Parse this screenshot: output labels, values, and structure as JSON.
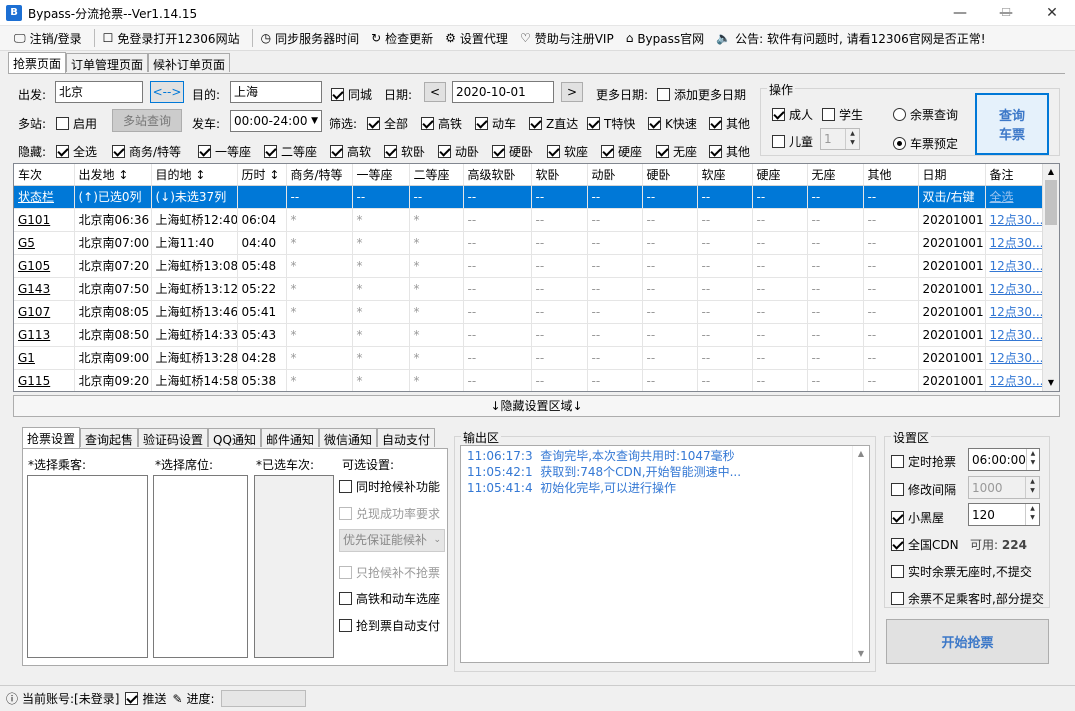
{
  "window": {
    "title": "Bypass-分流抢票--Ver1.14.15",
    "min_glyph": "—",
    "max_glyph": "☐",
    "close_glyph": "✕"
  },
  "menu": [
    {
      "icon": "monitor-icon",
      "glyph": "🖵",
      "label": "注销/登录"
    },
    {
      "icon": "window-icon",
      "glyph": "☐",
      "label": "免登录打开12306网站"
    },
    {
      "icon": "clock-icon",
      "glyph": "◷",
      "label": "同步服务器时间"
    },
    {
      "icon": "refresh-icon",
      "glyph": "↻",
      "label": "检查更新"
    },
    {
      "icon": "gear-icon",
      "glyph": "⚙",
      "label": "设置代理"
    },
    {
      "icon": "heart-icon",
      "glyph": "♡",
      "label": "赞助与注册VIP"
    },
    {
      "icon": "home-icon",
      "glyph": "⌂",
      "label": "Bypass官网"
    },
    {
      "icon": "speaker-icon",
      "glyph": "🔈",
      "label": "公告: 软件有问题时, 请看12306官网是否正常!"
    }
  ],
  "tabs": [
    "抢票页面",
    "订单管理页面",
    "候补订单页面"
  ],
  "query": {
    "from_label": "出发:",
    "from_value": "北京",
    "swap_label": "<-->",
    "to_label": "目的:",
    "to_value": "上海",
    "same_city": "同城",
    "date_label": "日期:",
    "date_value": "2020-10-01",
    "prev": "<",
    "next": ">",
    "more_dates_label": "更多日期:",
    "add_dates": "添加更多日期",
    "multi_label": "多站:",
    "enable": "启用",
    "multi_query": "多站查询",
    "depart_label": "发车:",
    "depart_value": "00:00-24:00",
    "filter_label": "筛选:",
    "filters": [
      "全部",
      "高铁",
      "动车",
      "Z直达",
      "T特快",
      "K快速",
      "其他"
    ],
    "hide_label": "隐藏:",
    "hides": [
      "全选",
      "商务/特等",
      "一等座",
      "二等座",
      "高软",
      "软卧",
      "动卧",
      "硬卧",
      "软座",
      "硬座",
      "无座",
      "其他"
    ]
  },
  "ops": {
    "title": "操作",
    "adult": "成人",
    "student": "学生",
    "child": "儿童",
    "child_count": "1",
    "remain_query": "余票查询",
    "book": "车票预定",
    "query_btn_1": "查询",
    "query_btn_2": "车票"
  },
  "table": {
    "headers": [
      "车次",
      "出发地 ↕",
      "目的地 ↕",
      "历时 ↕",
      "商务/特等",
      "一等座",
      "二等座",
      "高级软卧",
      "软卧",
      "动卧",
      "硬卧",
      "软座",
      "硬座",
      "无座",
      "其他",
      "日期",
      "备注"
    ],
    "rows": [
      [
        "状态栏",
        "(↑)已选0列",
        "(↓)未选37列",
        "",
        "--",
        "--",
        "--",
        "--",
        "--",
        "--",
        "--",
        "--",
        "--",
        "--",
        "--",
        "双击/右键",
        "全选"
      ],
      [
        "G101",
        "北京南06:36",
        "上海虹桥12:40",
        "06:04",
        "*",
        "*",
        "*",
        "--",
        "--",
        "--",
        "--",
        "--",
        "--",
        "--",
        "--",
        "20201001",
        "12点30..."
      ],
      [
        "G5",
        "北京南07:00",
        "上海11:40",
        "04:40",
        "*",
        "*",
        "*",
        "--",
        "--",
        "--",
        "--",
        "--",
        "--",
        "--",
        "--",
        "20201001",
        "12点30..."
      ],
      [
        "G105",
        "北京南07:20",
        "上海虹桥13:08",
        "05:48",
        "*",
        "*",
        "*",
        "--",
        "--",
        "--",
        "--",
        "--",
        "--",
        "--",
        "--",
        "20201001",
        "12点30..."
      ],
      [
        "G143",
        "北京南07:50",
        "上海虹桥13:12",
        "05:22",
        "*",
        "*",
        "*",
        "--",
        "--",
        "--",
        "--",
        "--",
        "--",
        "--",
        "--",
        "20201001",
        "12点30..."
      ],
      [
        "G107",
        "北京南08:05",
        "上海虹桥13:46",
        "05:41",
        "*",
        "*",
        "*",
        "--",
        "--",
        "--",
        "--",
        "--",
        "--",
        "--",
        "--",
        "20201001",
        "12点30..."
      ],
      [
        "G113",
        "北京南08:50",
        "上海虹桥14:33",
        "05:43",
        "*",
        "*",
        "*",
        "--",
        "--",
        "--",
        "--",
        "--",
        "--",
        "--",
        "--",
        "20201001",
        "12点30..."
      ],
      [
        "G1",
        "北京南09:00",
        "上海虹桥13:28",
        "04:28",
        "*",
        "*",
        "*",
        "--",
        "--",
        "--",
        "--",
        "--",
        "--",
        "--",
        "--",
        "20201001",
        "12点30..."
      ],
      [
        "G115",
        "北京南09:20",
        "上海虹桥14:58",
        "05:38",
        "*",
        "*",
        "*",
        "--",
        "--",
        "--",
        "--",
        "--",
        "--",
        "--",
        "--",
        "20201001",
        "12点30..."
      ]
    ]
  },
  "hide_bar": "↓隐藏设置区域↓",
  "bottom_tabs": [
    "抢票设置",
    "查询起售",
    "验证码设置",
    "QQ通知",
    "邮件通知",
    "微信通知",
    "自动支付"
  ],
  "grab": {
    "passengers": "*选择乘客:",
    "seats": "*选择席位:",
    "trains": "*已选车次:",
    "options": "可选设置:",
    "opt_waitlist": "同时抢候补功能",
    "opt_success": "兑现成功率要求",
    "opt_priority": "优先保证能候补",
    "opt_only_wait": "只抢候补不抢票",
    "opt_mixed": "高铁和动车选座",
    "opt_autopay": "抢到票自动支付"
  },
  "output": {
    "title": "输出区",
    "lines": [
      {
        "time": "11:06:17:3",
        "msg": "查询完毕,本次查询共用时:1047毫秒"
      },
      {
        "time": "11:05:42:1",
        "msg": "获取到:748个CDN,开始智能测速中..."
      },
      {
        "time": "11:05:41:4",
        "msg": "初始化完毕,可以进行操作"
      }
    ]
  },
  "settings": {
    "title": "设置区",
    "timed": "定时抢票",
    "timed_value": "06:00:00",
    "interval": "修改间隔",
    "interval_value": "1000",
    "blackroom": "小黑屋",
    "blackroom_value": "120",
    "cdn": "全国CDN",
    "cdn_avail_label": "可用:",
    "cdn_avail": "224",
    "realtime": "实时余票无座时,不提交",
    "partial": "余票不足乘客时,部分提交",
    "start": "开始抢票"
  },
  "status": {
    "account": "当前账号:[未登录]",
    "push": "推送",
    "progress": "进度:"
  },
  "colors": {
    "accent": "#0078d7",
    "link": "#3478d4",
    "output_text": "#3478d4",
    "start_btn": "#3c78c8"
  }
}
